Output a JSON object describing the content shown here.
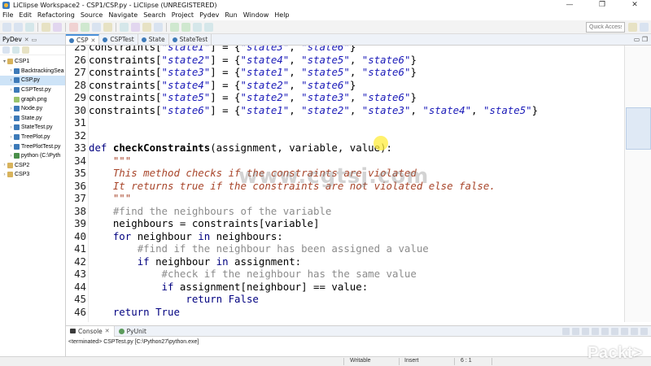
{
  "window": {
    "title": "LiClipse Workspace2 - CSP1/CSP.py - LiClipse (UNREGISTERED)",
    "minimize_glyph": "—",
    "maximize_glyph": "❐",
    "close_glyph": "✕"
  },
  "menu": [
    "File",
    "Edit",
    "Refactoring",
    "Source",
    "Navigate",
    "Search",
    "Project",
    "Pydev",
    "Run",
    "Window",
    "Help"
  ],
  "toolbar": {
    "quick_access_placeholder": "Quick Access"
  },
  "explorer": {
    "tab_label": "PyDev",
    "tree": [
      {
        "label": "CSP1",
        "icon": "project-icon",
        "depth": 0,
        "expanded": true
      },
      {
        "label": "BacktrackingSea",
        "icon": "python-file-icon",
        "depth": 1
      },
      {
        "label": "CSP.py",
        "icon": "python-file-icon",
        "depth": 1,
        "selected": true
      },
      {
        "label": "CSPTest.py",
        "icon": "python-file-icon",
        "depth": 1
      },
      {
        "label": "graph.png",
        "icon": "image-file-icon",
        "depth": 1
      },
      {
        "label": "Node.py",
        "icon": "python-file-icon",
        "depth": 1
      },
      {
        "label": "State.py",
        "icon": "python-file-icon",
        "depth": 1
      },
      {
        "label": "StateTest.py",
        "icon": "python-file-icon",
        "depth": 1
      },
      {
        "label": "TreePlot.py",
        "icon": "python-file-icon",
        "depth": 1
      },
      {
        "label": "TreePlotTest.py",
        "icon": "python-file-icon",
        "depth": 1
      },
      {
        "label": "python  (C:\\Pyth",
        "icon": "python-interpreter-icon",
        "depth": 1
      },
      {
        "label": "CSP2",
        "icon": "project-icon",
        "depth": 0
      },
      {
        "label": "CSP3",
        "icon": "project-icon",
        "depth": 0
      }
    ]
  },
  "editor": {
    "tabs": [
      {
        "label": "CSP",
        "active": true
      },
      {
        "label": "CSPTest",
        "active": false
      },
      {
        "label": "State",
        "active": false
      },
      {
        "label": "StateTest",
        "active": false
      }
    ],
    "lines": [
      {
        "n": "25",
        "html": "constraints[<span class=\"str\">\"state1\"</span>] = {<span class=\"str\">\"state3\"</span>, <span class=\"str\">\"state6\"</span>}"
      },
      {
        "n": "26",
        "html": "constraints[<span class=\"str\">\"state2\"</span>] = {<span class=\"str\">\"state4\"</span>, <span class=\"str\">\"state5\"</span>, <span class=\"str\">\"state6\"</span>}"
      },
      {
        "n": "27",
        "html": "constraints[<span class=\"str\">\"state3\"</span>] = {<span class=\"str\">\"state1\"</span>, <span class=\"str\">\"state5\"</span>, <span class=\"str\">\"state6\"</span>}"
      },
      {
        "n": "28",
        "html": "constraints[<span class=\"str\">\"state4\"</span>] = {<span class=\"str\">\"state2\"</span>, <span class=\"str\">\"state6\"</span>}"
      },
      {
        "n": "29",
        "html": "constraints[<span class=\"str\">\"state5\"</span>] = {<span class=\"str\">\"state2\"</span>, <span class=\"str\">\"state3\"</span>, <span class=\"str\">\"state6\"</span>}"
      },
      {
        "n": "30",
        "html": "constraints[<span class=\"str\">\"state6\"</span>] = {<span class=\"str\">\"state1\"</span>, <span class=\"str\">\"state2\"</span>, <span class=\"str\">\"state3\"</span>, <span class=\"str\">\"state4\"</span>, <span class=\"str\">\"state5\"</span>}"
      },
      {
        "n": "31",
        "html": ""
      },
      {
        "n": "32",
        "html": ""
      },
      {
        "n": "33",
        "html": "<span class=\"kw\">def</span> <span class=\"fn\">checkConstraints</span>(assignment, variable, value):"
      },
      {
        "n": "34",
        "html": "    <span class=\"doc\">\"\"\"</span>"
      },
      {
        "n": "35",
        "html": "    <span class=\"doc\">This method checks if the constraints are violated</span>"
      },
      {
        "n": "36",
        "html": "    <span class=\"doc\">It returns true if the constraints are not violated else false.</span>"
      },
      {
        "n": "37",
        "html": "    <span class=\"doc\">\"\"\"</span>"
      },
      {
        "n": "38",
        "html": "    <span class=\"com\">#find the neighbours of the variable</span>"
      },
      {
        "n": "39",
        "html": "    neighbours = constraints[variable]"
      },
      {
        "n": "40",
        "html": "    <span class=\"kw\">for</span> neighbour <span class=\"kw\">in</span> neighbours:"
      },
      {
        "n": "41",
        "html": "        <span class=\"com\">#find if the neighbour has been assigned a value</span>"
      },
      {
        "n": "42",
        "html": "        <span class=\"kw\">if</span> neighbour <span class=\"kw\">in</span> assignment:"
      },
      {
        "n": "43",
        "html": "            <span class=\"com\">#check if the neighbour has the same value</span>"
      },
      {
        "n": "44",
        "html": "            <span class=\"kw\">if</span> assignment[neighbour] == value:"
      },
      {
        "n": "45",
        "html": "                <span class=\"kw\">return</span> <span class=\"kw\">False</span>"
      },
      {
        "n": "46",
        "html": "    <span class=\"kw\">return</span> <span class=\"kw\">True</span>"
      }
    ]
  },
  "watermark": "www.cgtsj.com",
  "console": {
    "tabs": [
      "Console",
      "PyUnit"
    ],
    "output": "<terminated> CSPTest.py [C:\\Python27\\python.exe]"
  },
  "status": {
    "writable": "Writable",
    "insert": "Insert",
    "position": "6 : 1"
  },
  "brand": {
    "logo_text": "Packt>"
  },
  "colors": {
    "keyword": "#000080",
    "string": "#1a1ab8",
    "comment": "#8c8c8c",
    "docstring": "#a8452a",
    "accent": "#4a90d9"
  }
}
